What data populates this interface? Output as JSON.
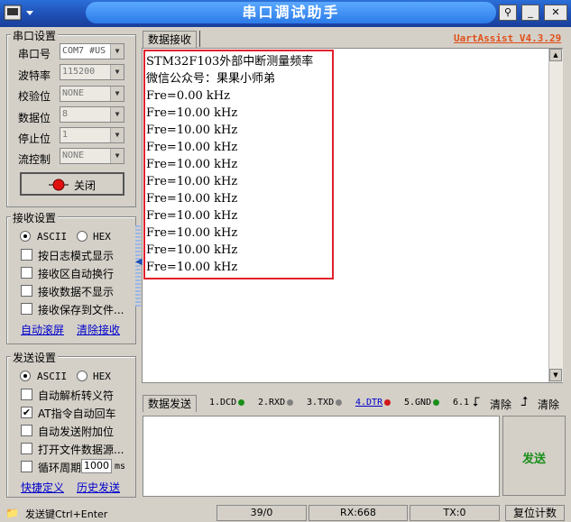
{
  "window": {
    "title": "串口调试助手"
  },
  "version_link": "UartAssist V4.3.29",
  "serial_settings": {
    "group_label": "串口设置",
    "port_label": "串口号",
    "port_value": "COM7 #US",
    "baud_label": "波特率",
    "baud_value": "115200",
    "parity_label": "校验位",
    "parity_value": "NONE",
    "databits_label": "数据位",
    "databits_value": "8",
    "stopbits_label": "停止位",
    "stopbits_value": "1",
    "flow_label": "流控制",
    "flow_value": "NONE",
    "close_button": "关闭"
  },
  "receive_settings": {
    "group_label": "接收设置",
    "ascii": "ASCII",
    "hex": "HEX",
    "options": [
      {
        "label": "按日志模式显示",
        "checked": false
      },
      {
        "label": "接收区自动换行",
        "checked": false
      },
      {
        "label": "接收数据不显示",
        "checked": false
      },
      {
        "label": "接收保存到文件...",
        "checked": false
      }
    ],
    "auto_scroll": "自动滚屏",
    "clear_receive": "清除接收"
  },
  "send_settings": {
    "group_label": "发送设置",
    "ascii": "ASCII",
    "hex": "HEX",
    "options": [
      {
        "label": "自动解析转义符",
        "checked": false
      },
      {
        "label": "AT指令自动回车",
        "checked": true
      },
      {
        "label": "自动发送附加位",
        "checked": false
      },
      {
        "label": "打开文件数据源...",
        "checked": false
      }
    ],
    "cycle_label": "循环周期",
    "cycle_value": "1000",
    "cycle_unit": "ms",
    "shortcut_def": "快捷定义",
    "history_send": "历史发送"
  },
  "receive_area": {
    "tab": "数据接收",
    "lines": [
      "STM32F103外部中断测量频率",
      "微信公众号：果果小师弟",
      "Fre=0.00 kHz",
      "Fre=10.00 kHz",
      "Fre=10.00 kHz",
      "Fre=10.00 kHz",
      "Fre=10.00 kHz",
      "Fre=10.00 kHz",
      "Fre=10.00 kHz",
      "Fre=10.00 kHz",
      "Fre=10.00 kHz",
      "Fre=10.00 kHz",
      "Fre=10.00 kHz",
      "Fre=10.00 kHz"
    ]
  },
  "send_area": {
    "tab": "数据发送",
    "signals": [
      {
        "label": "1.DCD",
        "color": "#1a8f1a"
      },
      {
        "label": "2.RXD",
        "color": "#808080"
      },
      {
        "label": "3.TXD",
        "color": "#808080"
      },
      {
        "label": "4.DTR",
        "color": "#d01818"
      },
      {
        "label": "5.GND",
        "color": "#1a8f1a"
      },
      {
        "label": "6.1",
        "color": "#808080"
      }
    ],
    "clear1": "清除",
    "clear2": "清除",
    "send_button": "发送"
  },
  "status_bar": {
    "hint": "发送键Ctrl+Enter",
    "count": "39/0",
    "rx": "RX:668",
    "tx": "TX:0",
    "reset": "复位计数"
  }
}
